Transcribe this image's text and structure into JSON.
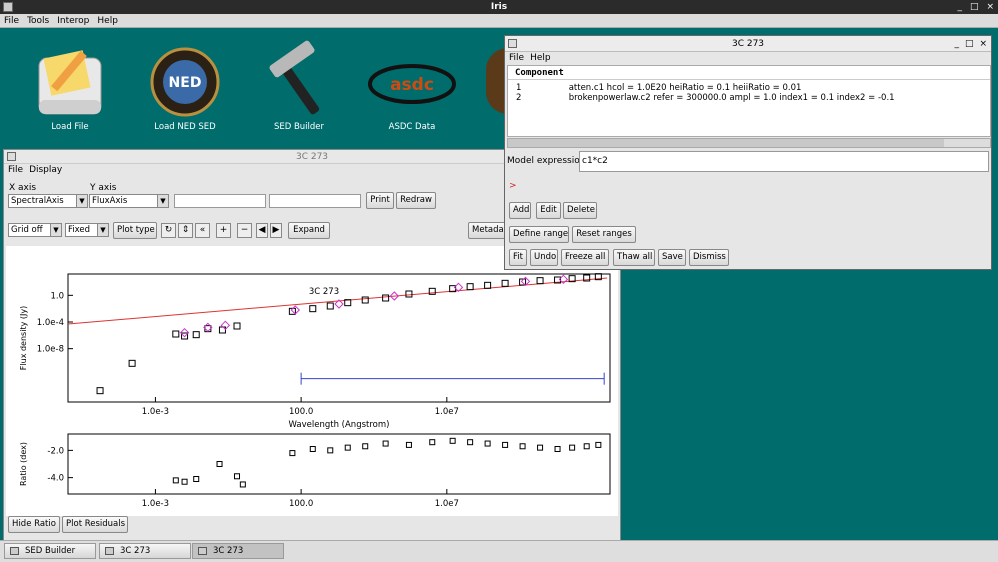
{
  "app": {
    "title": "Iris",
    "window_controls": [
      "_",
      "□",
      "×"
    ]
  },
  "menubar": [
    "File",
    "Tools",
    "Interop",
    "Help"
  ],
  "desktop_icons": [
    {
      "label": "Load File",
      "icon": "load-file-icon"
    },
    {
      "label": "Load NED SED",
      "icon": "ned-icon"
    },
    {
      "label": "SED Builder",
      "icon": "hammer-icon"
    },
    {
      "label": "ASDC Data",
      "icon": "asdc-icon"
    }
  ],
  "plot_window": {
    "title": "3C 273",
    "menu": [
      "File",
      "Display"
    ],
    "x_axis_label": "X axis",
    "y_axis_label": "Y axis",
    "x_axis_value": "SpectralAxis",
    "y_axis_value": "FluxAxis",
    "print_button": "Print",
    "redraw_button": "Redraw",
    "grid_value": "Grid off",
    "fixed_value": "Fixed",
    "plot_type_button": "Plot type",
    "expand_button": "Expand",
    "metadata_button": "Metadata",
    "hide_ratio_button": "Hide Ratio",
    "plot_residuals_button": "Plot Residuals"
  },
  "fit_window": {
    "title": "3C 273",
    "menu": [
      "File",
      "Help"
    ],
    "component_header": "Component",
    "components": [
      {
        "index": "1",
        "text": "atten.c1   hcol = 1.0E20 heiRatio = 0.1 heiiRatio = 0.01"
      },
      {
        "index": "2",
        "text": "brokenpowerlaw.c2   refer = 300000.0 ampl = 1.0 index1 = 0.1 index2 = -0.1"
      }
    ],
    "model_expression_label": "Model expression:",
    "model_expression_value": "c1*c2",
    "error_marker": ">",
    "buttons_row1": [
      "Add",
      "Edit",
      "Delete"
    ],
    "buttons_row2": [
      "Define range",
      "Reset ranges"
    ],
    "buttons_row3": [
      "Fit",
      "Undo",
      "Freeze all",
      "Thaw all",
      "Save",
      "Dismiss"
    ]
  },
  "taskbar": [
    "SED Builder",
    "3C 273",
    "3C 273"
  ],
  "chart_data": {
    "type": "scatter",
    "title": "3C 273",
    "xlabel": "Wavelength (Angstrom)",
    "ylabel": "Flux density (Jy)",
    "x_scale": "log",
    "y_scale": "log",
    "x_ticks": [
      "1.0e-3",
      "100.0",
      "1.0e7"
    ],
    "y_ticks": [
      "1.0",
      "1.0e-4",
      "1.0e-8"
    ],
    "ratio_ylabel": "Ratio (dex)",
    "ratio_y_ticks": [
      "-2.0",
      "-4.0"
    ],
    "ratio_x_ticks": [
      "1.0e-3",
      "100.0",
      "1.0e7"
    ],
    "colors": {
      "data": "#000000",
      "model_points": "#cc33cc",
      "model_line": "#dd3333",
      "range": "#3344cc"
    },
    "series": [
      {
        "name": "data",
        "points": [
          [
            -4.9,
            -14.3
          ],
          [
            -3.8,
            -10.2
          ],
          [
            -2.3,
            -5.8
          ],
          [
            -2.0,
            -6.1
          ],
          [
            -1.6,
            -5.9
          ],
          [
            -1.2,
            -5.0
          ],
          [
            -0.7,
            -5.2
          ],
          [
            -0.2,
            -4.6
          ],
          [
            1.7,
            -2.4
          ],
          [
            2.4,
            -2.0
          ],
          [
            3.0,
            -1.6
          ],
          [
            3.6,
            -1.1
          ],
          [
            4.2,
            -0.7
          ],
          [
            4.9,
            -0.4
          ],
          [
            5.7,
            0.2
          ],
          [
            6.5,
            0.6
          ],
          [
            7.2,
            1.0
          ],
          [
            7.8,
            1.3
          ],
          [
            8.4,
            1.5
          ],
          [
            9.0,
            1.8
          ],
          [
            9.6,
            2.0
          ],
          [
            10.2,
            2.2
          ],
          [
            10.8,
            2.3
          ],
          [
            11.3,
            2.5
          ],
          [
            11.8,
            2.6
          ],
          [
            12.2,
            2.8
          ]
        ]
      },
      {
        "name": "model",
        "points": [
          [
            -2.0,
            -5.6
          ],
          [
            -1.2,
            -4.8
          ],
          [
            -0.6,
            -4.5
          ],
          [
            1.8,
            -2.2
          ],
          [
            3.3,
            -1.3
          ],
          [
            5.2,
            -0.1
          ],
          [
            7.4,
            1.2
          ],
          [
            9.7,
            2.1
          ],
          [
            11.0,
            2.4
          ]
        ]
      }
    ],
    "model_line": [
      [
        -6.0,
        -4.3
      ],
      [
        12.5,
        2.6
      ]
    ],
    "range": [
      2.0,
      12.4
    ],
    "ratio_points": [
      [
        -2.3,
        -4.2
      ],
      [
        -2.0,
        -4.3
      ],
      [
        -1.6,
        -4.1
      ],
      [
        -0.8,
        -3.0
      ],
      [
        -0.2,
        -3.9
      ],
      [
        0.0,
        -4.5
      ],
      [
        1.7,
        -2.2
      ],
      [
        2.4,
        -1.9
      ],
      [
        3.0,
        -2.0
      ],
      [
        3.6,
        -1.8
      ],
      [
        4.2,
        -1.7
      ],
      [
        4.9,
        -1.5
      ],
      [
        5.7,
        -1.6
      ],
      [
        6.5,
        -1.4
      ],
      [
        7.2,
        -1.3
      ],
      [
        7.8,
        -1.4
      ],
      [
        8.4,
        -1.5
      ],
      [
        9.0,
        -1.6
      ],
      [
        9.6,
        -1.7
      ],
      [
        10.2,
        -1.8
      ],
      [
        10.8,
        -1.9
      ],
      [
        11.3,
        -1.8
      ],
      [
        11.8,
        -1.7
      ],
      [
        12.2,
        -1.6
      ]
    ]
  }
}
